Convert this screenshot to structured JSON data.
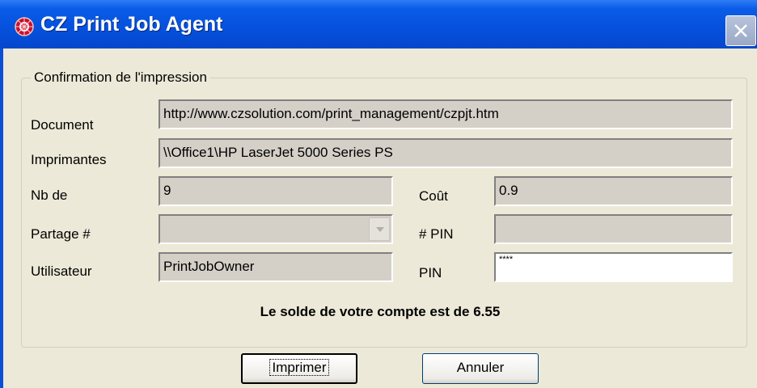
{
  "window": {
    "title": "CZ Print Job Agent"
  },
  "groupbox": {
    "title": "Confirmation de l'impression"
  },
  "labels": {
    "document": "Document",
    "imprimantes": "Imprimantes",
    "nb_de": "Nb de",
    "cout": "Coût",
    "partage": "Partage  #",
    "pin_number": "# PIN",
    "utilisateur": "Utilisateur",
    "pin": "PIN"
  },
  "fields": {
    "document": "http://www.czsolution.com/print_management/czpjt.htm",
    "imprimantes": "\\\\Office1\\HP LaserJet 5000 Series PS",
    "nb_de": "9",
    "cout": "0.9",
    "partage": "",
    "pin_number": "",
    "utilisateur": "PrintJobOwner",
    "pin": "****"
  },
  "balance_text": "Le solde de votre compte est de 6.55",
  "buttons": {
    "print": "Imprimer",
    "cancel": "Annuler"
  },
  "icons": {
    "app": "cz-logo-icon",
    "close": "close-icon"
  }
}
